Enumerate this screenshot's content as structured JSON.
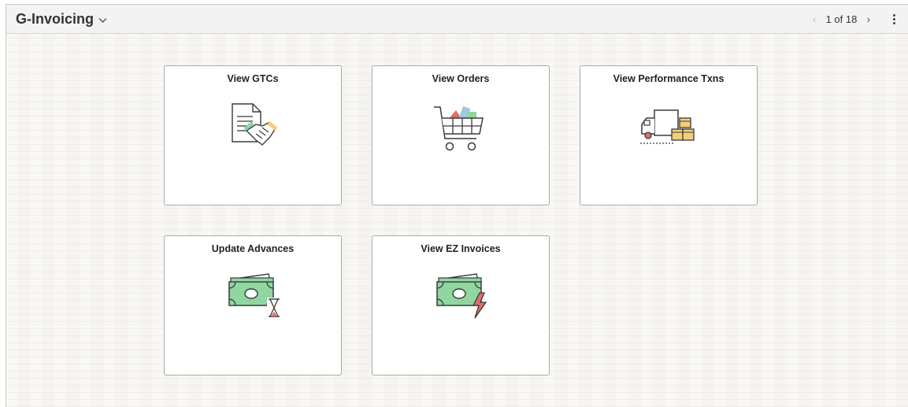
{
  "header": {
    "title": "G-Invoicing",
    "pagination": {
      "current": 1,
      "total": 18,
      "text": "1 of 18"
    }
  },
  "tiles": [
    {
      "label": "View GTCs",
      "icon": "contract-handshake-icon"
    },
    {
      "label": "View Orders",
      "icon": "shopping-cart-icon"
    },
    {
      "label": "View Performance Txns",
      "icon": "delivery-truck-icon"
    },
    {
      "label": "Update Advances",
      "icon": "money-hourglass-icon"
    },
    {
      "label": "View EZ Invoices",
      "icon": "money-lightning-icon"
    }
  ],
  "colors": {
    "accent_green": "#8fd6a0",
    "accent_red": "#e06c6c",
    "accent_box": "#f3cf7a",
    "icon_stroke": "#3a3a3a"
  }
}
